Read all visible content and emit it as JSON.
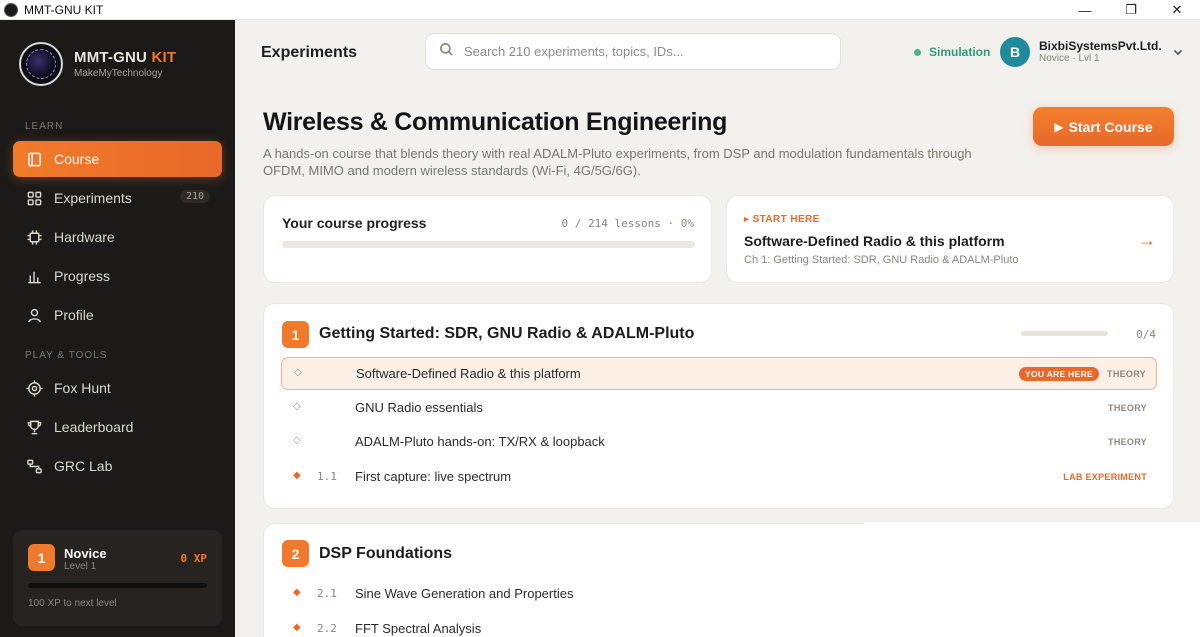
{
  "window": {
    "title": "MMT-GNU KIT",
    "minimize": "—",
    "maximize": "❐",
    "close": "✕"
  },
  "brand": {
    "name": "MMT-GNU",
    "name_accent": "KIT",
    "tagline": "MakeMyTechnology"
  },
  "sidebar": {
    "sections": [
      {
        "label": "LEARN",
        "items": [
          {
            "label": "Course",
            "icon": "book-icon",
            "active": true
          },
          {
            "label": "Experiments",
            "icon": "grid-icon",
            "badge": "210"
          },
          {
            "label": "Hardware",
            "icon": "chip-icon"
          },
          {
            "label": "Progress",
            "icon": "bar-chart-icon"
          },
          {
            "label": "Profile",
            "icon": "user-icon"
          }
        ]
      },
      {
        "label": "PLAY & TOOLS",
        "items": [
          {
            "label": "Fox Hunt",
            "icon": "target-icon"
          },
          {
            "label": "Leaderboard",
            "icon": "trophy-icon"
          },
          {
            "label": "GRC Lab",
            "icon": "flow-icon"
          }
        ]
      }
    ],
    "xp": {
      "level": "1",
      "rank": "Novice",
      "level_label": "Level 1",
      "value": "0 XP",
      "next": "100 XP to next level",
      "progress": 0.0
    }
  },
  "header": {
    "title": "Experiments",
    "search_placeholder": "Search 210 experiments, topics, IDs...",
    "mode": "Simulation",
    "user": {
      "initial": "B",
      "name": "BixbiSystemsPvt.Ltd.",
      "level": "Novice · Lvl 1"
    }
  },
  "course": {
    "title": "Wireless & Communication Engineering",
    "description": "A hands-on course that blends theory with real ADALM-Pluto experiments, from DSP and modulation fundamentals through OFDM, MIMO and modern wireless standards (Wi-Fi, 4G/5G/6G).",
    "start_button": "Start Course",
    "progress": {
      "label": "Your course progress",
      "count": "0 / 214 lessons · 0%",
      "fraction": 0.0
    },
    "start_here": {
      "label": "▸ START HERE",
      "title": "Software-Defined Radio & this platform",
      "subtitle": "Ch 1: Getting Started: SDR, GNU Radio & ADALM-Pluto",
      "arrow": "→"
    }
  },
  "chapters": [
    {
      "number": "1",
      "title": "Getting Started: SDR, GNU Radio & ADALM-Pluto",
      "count": "0/4",
      "fraction": 0.0,
      "lessons": [
        {
          "bullet": "◇",
          "num": "",
          "title": "Software-Defined Radio & this platform",
          "tag": "THEORY",
          "current": true,
          "here": "YOU ARE HERE"
        },
        {
          "bullet": "◇",
          "num": "",
          "title": "GNU Radio essentials",
          "tag": "THEORY"
        },
        {
          "bullet": "◇",
          "num": "",
          "title": "ADALM-Pluto hands-on: TX/RX & loopback",
          "tag": "THEORY"
        },
        {
          "bullet": "◆",
          "num": "1.1",
          "title": "First capture: live spectrum",
          "tag": "LAB EXPERIMENT",
          "lab": true
        }
      ]
    },
    {
      "number": "2",
      "title": "DSP Foundations",
      "count": "",
      "fraction": 0.0,
      "lessons": [
        {
          "bullet": "◆",
          "num": "2.1",
          "title": "Sine Wave Generation and Properties",
          "tag": "",
          "lab": true
        },
        {
          "bullet": "◆",
          "num": "2.2",
          "title": "FFT Spectral Analysis",
          "tag": "",
          "lab": true
        }
      ]
    }
  ]
}
